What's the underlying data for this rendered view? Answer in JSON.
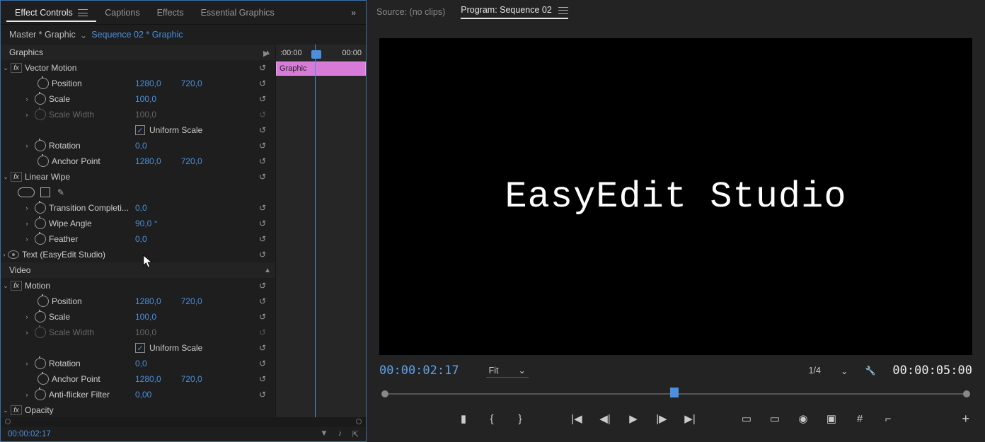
{
  "tabs": {
    "effect_controls": "Effect Controls",
    "captions": "Captions",
    "effects": "Effects",
    "essential_graphics": "Essential Graphics"
  },
  "master": {
    "left": "Master * Graphic",
    "right": "Sequence 02 * Graphic"
  },
  "timeline": {
    "start": ":00:00",
    "end": "00:00",
    "clip_label": "Graphic"
  },
  "sections": {
    "graphics": "Graphics",
    "vector_motion": "Vector Motion",
    "linear_wipe": "Linear Wipe",
    "text_layer": "Text (EasyEdit Studio)",
    "video": "Video",
    "motion": "Motion",
    "opacity": "Opacity"
  },
  "props": {
    "position": "Position",
    "scale": "Scale",
    "scale_width": "Scale Width",
    "uniform_scale": "Uniform Scale",
    "rotation": "Rotation",
    "anchor_point": "Anchor Point",
    "transition_completion": "Transition Completi...",
    "wipe_angle": "Wipe Angle",
    "feather": "Feather",
    "anti_flicker": "Anti-flicker Filter"
  },
  "values": {
    "pos_x": "1280,0",
    "pos_y": "720,0",
    "scale": "100,0",
    "scale_width": "100,0",
    "rotation": "0,0",
    "anchor_x": "1280,0",
    "anchor_y": "720,0",
    "transition": "0,0",
    "wipe_angle": "90,0 °",
    "feather": "0,0",
    "anti_flicker": "0,00"
  },
  "footer": {
    "timecode": "00:00:02:17"
  },
  "source": {
    "label": "Source: (no clips)",
    "program": "Program: Sequence 02"
  },
  "viewer": {
    "text": "EasyEdit Studio"
  },
  "transport": {
    "timecode": "00:00:02:17",
    "duration": "00:00:05:00",
    "fit": "Fit",
    "resolution": "1/4"
  }
}
